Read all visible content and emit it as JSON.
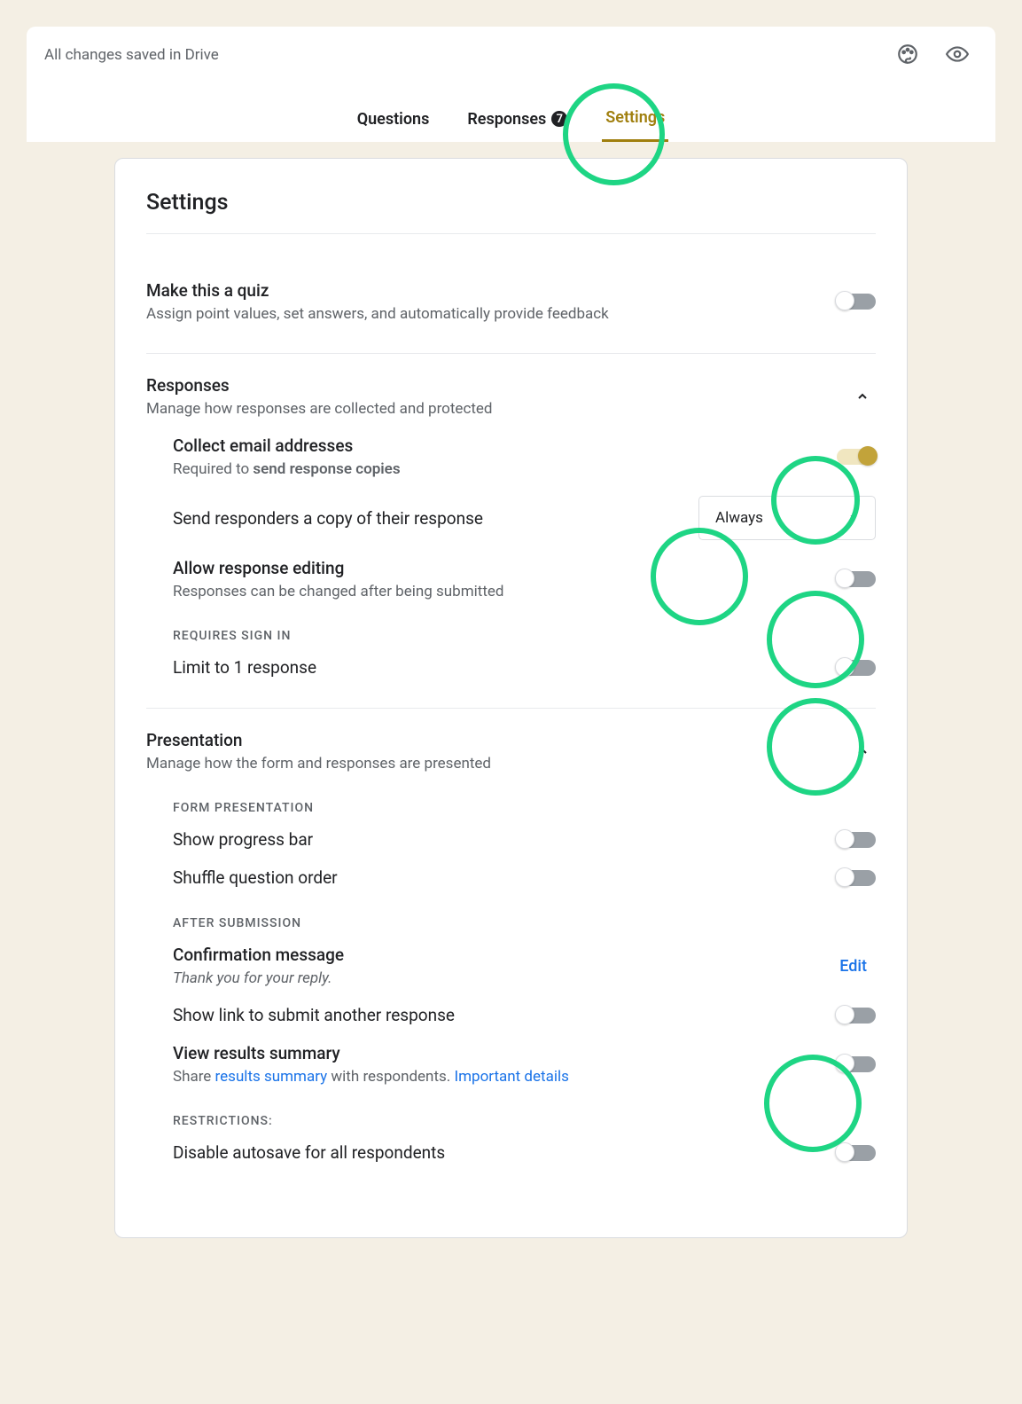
{
  "topbar": {
    "save_status": "All changes saved in Drive",
    "tabs": {
      "questions": "Questions",
      "responses": "Responses",
      "responses_count": "7",
      "settings": "Settings"
    }
  },
  "card": {
    "title": "Settings"
  },
  "quiz": {
    "title": "Make this a quiz",
    "sub": "Assign point values, set answers, and automatically provide feedback"
  },
  "responses": {
    "title": "Responses",
    "sub": "Manage how responses are collected and protected",
    "collect_title": "Collect email addresses",
    "collect_sub_a": "Required to ",
    "collect_sub_b": "send response copies",
    "send_copy_title": "Send responders a copy of their response",
    "send_copy_value": "Always",
    "allow_edit_title": "Allow response editing",
    "allow_edit_sub": "Responses can be changed after being submitted",
    "requires_signin": "REQUIRES SIGN IN",
    "limit_title": "Limit to 1 response"
  },
  "presentation": {
    "title": "Presentation",
    "sub": "Manage how the form and responses are presented",
    "form_head": "FORM PRESENTATION",
    "progress_title": "Show progress bar",
    "shuffle_title": "Shuffle question order",
    "after_head": "AFTER SUBMISSION",
    "confirm_title": "Confirmation message",
    "confirm_sub": "Thank you for your reply.",
    "edit_label": "Edit",
    "show_link_title": "Show link to submit another response",
    "view_results_title": "View results summary",
    "view_results_a": "Share ",
    "view_results_link1": "results summary",
    "view_results_b": " with respondents. ",
    "view_results_link2": "Important details",
    "restrictions_head": "RESTRICTIONS:",
    "disable_autosave_title": "Disable autosave for all respondents"
  }
}
